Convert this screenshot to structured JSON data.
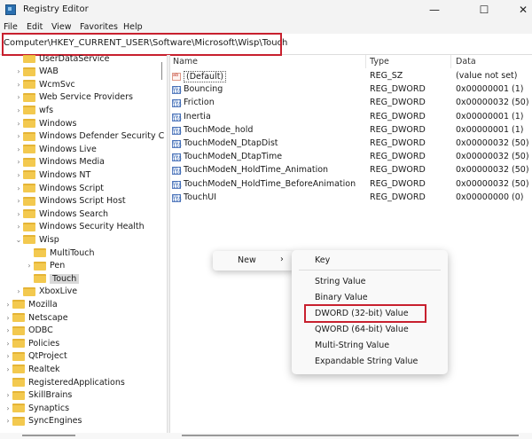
{
  "window": {
    "title": "Registry Editor",
    "minimize": "—",
    "maximize": "☐",
    "close": "✕"
  },
  "menu": [
    "File",
    "Edit",
    "View",
    "Favorites",
    "Help"
  ],
  "address": "Computer\\HKEY_CURRENT_USER\\Software\\Microsoft\\Wisp\\Touch",
  "tree": [
    {
      "label": "UserDataService",
      "depth": 2,
      "expandable": false
    },
    {
      "label": "WAB",
      "depth": 2,
      "expandable": true
    },
    {
      "label": "WcmSvc",
      "depth": 2,
      "expandable": true
    },
    {
      "label": "Web Service Providers",
      "depth": 2,
      "expandable": true
    },
    {
      "label": "wfs",
      "depth": 2,
      "expandable": true
    },
    {
      "label": "Windows",
      "depth": 2,
      "expandable": true
    },
    {
      "label": "Windows Defender Security C",
      "depth": 2,
      "expandable": true
    },
    {
      "label": "Windows Live",
      "depth": 2,
      "expandable": true
    },
    {
      "label": "Windows Media",
      "depth": 2,
      "expandable": true
    },
    {
      "label": "Windows NT",
      "depth": 2,
      "expandable": true
    },
    {
      "label": "Windows Script",
      "depth": 2,
      "expandable": true
    },
    {
      "label": "Windows Script Host",
      "depth": 2,
      "expandable": true
    },
    {
      "label": "Windows Search",
      "depth": 2,
      "expandable": true
    },
    {
      "label": "Windows Security Health",
      "depth": 2,
      "expandable": true
    },
    {
      "label": "Wisp",
      "depth": 2,
      "expandable": true,
      "expanded": true
    },
    {
      "label": "MultiTouch",
      "depth": 3,
      "expandable": false
    },
    {
      "label": "Pen",
      "depth": 3,
      "expandable": true
    },
    {
      "label": "Touch",
      "depth": 3,
      "expandable": false,
      "selected": true
    },
    {
      "label": "XboxLive",
      "depth": 2,
      "expandable": true
    },
    {
      "label": "Mozilla",
      "depth": 1,
      "expandable": true
    },
    {
      "label": "Netscape",
      "depth": 1,
      "expandable": true
    },
    {
      "label": "ODBC",
      "depth": 1,
      "expandable": true
    },
    {
      "label": "Policies",
      "depth": 1,
      "expandable": true
    },
    {
      "label": "QtProject",
      "depth": 1,
      "expandable": true
    },
    {
      "label": "Realtek",
      "depth": 1,
      "expandable": true
    },
    {
      "label": "RegisteredApplications",
      "depth": 1,
      "expandable": false
    },
    {
      "label": "SkillBrains",
      "depth": 1,
      "expandable": true
    },
    {
      "label": "Synaptics",
      "depth": 1,
      "expandable": true
    },
    {
      "label": "SyncEngines",
      "depth": 1,
      "expandable": true
    }
  ],
  "columns": {
    "name": "Name",
    "type": "Type",
    "data": "Data"
  },
  "values": [
    {
      "name": "(Default)",
      "type": "REG_SZ",
      "data": "(value not set)",
      "icon": "ab"
    },
    {
      "name": "Bouncing",
      "type": "REG_DWORD",
      "data": "0x00000001 (1)",
      "icon": "bin"
    },
    {
      "name": "Friction",
      "type": "REG_DWORD",
      "data": "0x00000032 (50)",
      "icon": "bin"
    },
    {
      "name": "Inertia",
      "type": "REG_DWORD",
      "data": "0x00000001 (1)",
      "icon": "bin"
    },
    {
      "name": "TouchMode_hold",
      "type": "REG_DWORD",
      "data": "0x00000001 (1)",
      "icon": "bin"
    },
    {
      "name": "TouchModeN_DtapDist",
      "type": "REG_DWORD",
      "data": "0x00000032 (50)",
      "icon": "bin"
    },
    {
      "name": "TouchModeN_DtapTime",
      "type": "REG_DWORD",
      "data": "0x00000032 (50)",
      "icon": "bin"
    },
    {
      "name": "TouchModeN_HoldTime_Animation",
      "type": "REG_DWORD",
      "data": "0x00000032 (50)",
      "icon": "bin"
    },
    {
      "name": "TouchModeN_HoldTime_BeforeAnimation",
      "type": "REG_DWORD",
      "data": "0x00000032 (50)",
      "icon": "bin"
    },
    {
      "name": "TouchUI",
      "type": "REG_DWORD",
      "data": "0x00000000 (0)",
      "icon": "bin"
    }
  ],
  "context_menu": {
    "new_label": "New",
    "arrow": "›"
  },
  "submenu": [
    "Key",
    "String Value",
    "Binary Value",
    "DWORD (32-bit) Value",
    "QWORD (64-bit) Value",
    "Multi-String Value",
    "Expandable String Value"
  ],
  "highlight_color": "#c8202e"
}
